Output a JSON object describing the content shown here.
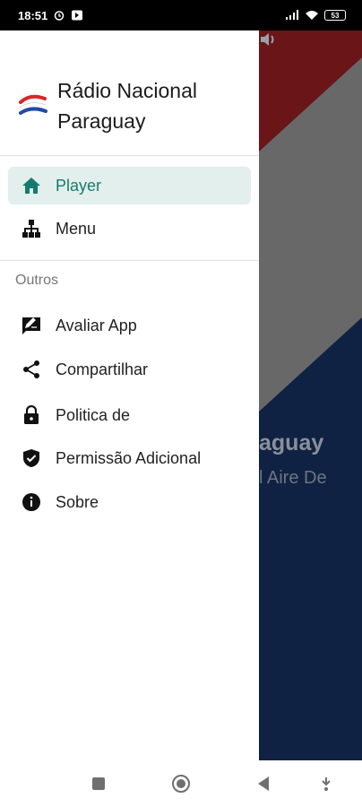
{
  "status_bar": {
    "time": "18:51",
    "battery": "53"
  },
  "drawer": {
    "app_title": "Rádio Nacional Paraguay",
    "primary_items": [
      {
        "label": "Player",
        "icon": "home-icon",
        "active": true
      },
      {
        "label": "Menu",
        "icon": "sitemap-icon",
        "active": false
      }
    ],
    "section_title": "Outros",
    "secondary_items": [
      {
        "label": "Avaliar App",
        "icon": "rate-review-icon"
      },
      {
        "label": "Compartilhar",
        "icon": "share-icon"
      },
      {
        "label": "Politica de",
        "icon": "lock-icon"
      },
      {
        "label": "Permissão Adicional",
        "icon": "shield-check-icon"
      },
      {
        "label": "Sobre",
        "icon": "info-icon"
      }
    ]
  },
  "background": {
    "title_fragment": "aguay",
    "subtitle_fragment": "l Aire De"
  },
  "colors": {
    "accent": "#167a6e",
    "active_bg": "#e2efec",
    "bg_red": "#7a1a1a",
    "bg_grey": "#6b6b6b",
    "bg_navy": "#0f2244"
  }
}
